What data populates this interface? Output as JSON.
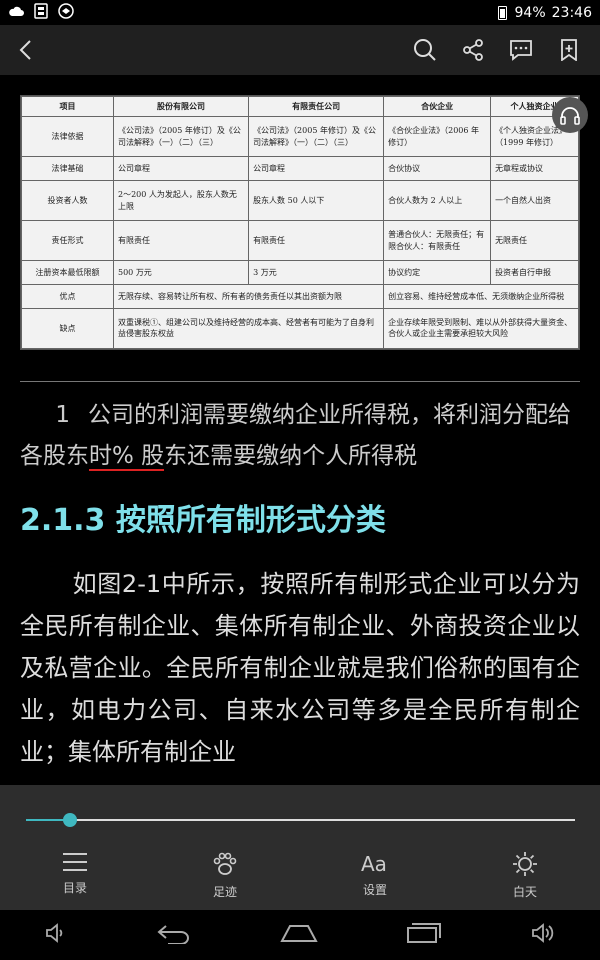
{
  "status_bar": {
    "battery": "94%",
    "time": "23:46"
  },
  "table": {
    "headers": [
      "项目",
      "股份有限公司",
      "有限责任公司",
      "合伙企业",
      "个人独资企业"
    ],
    "rows": [
      [
        "法律依据",
        "《公司法》（2005 年修订）及《公司法解释》（一）（二）（三）",
        "《公司法》（2005 年修订）及《公司法解释》（一）（二）（三）",
        "《合伙企业法》（2006 年修订）",
        "《个人独资企业法》（1999 年修订）"
      ],
      [
        "法律基础",
        "公司章程",
        "公司章程",
        "合伙协议",
        "无章程或协议"
      ],
      [
        "投资者人数",
        "2～200 人为发起人，股东人数无上限",
        "股东人数 50 人以下",
        "合伙人数为 2 人以上",
        "一个自然人出资"
      ],
      [
        "责任形式",
        "有限责任",
        "有限责任",
        "普通合伙人：无限责任；有限合伙人：有限责任",
        "无限责任"
      ],
      [
        "注册资本最低限额",
        "500 万元",
        "3 万元",
        "协议约定",
        "投资者自行申报"
      ]
    ],
    "merged_rows": [
      [
        "优点",
        "无限存续、容易转让所有权、所有者的债务责任以其出资额为限",
        "创立容易、维持经营成本低、无须缴纳企业所得税"
      ],
      [
        "缺点",
        "双重课税①、组建公司以及维持经营的成本高、经营者有可能为了自身利益侵害股东权益",
        "企业存续年限受到限制、难以从外部获得大量资金、合伙人或企业主需要承担较大风险"
      ]
    ]
  },
  "footnote": {
    "number": "1",
    "text_before": "公司的利润需要缴纳企业所得税，将利润分配给各股东",
    "underlined": "时% 股",
    "text_after": "东还需要缴纳个人所得税"
  },
  "section": {
    "heading": "2.1.3 按照所有制形式分类",
    "paragraph": "如图2-1中所示，按照所有制形式企业可以分为全民所有制企业、集体所有制企业、外商投资企业以及私营企业。全民所有制企业就是我们俗称的国有企业，如电力公司、自来水公司等多是全民所有制企业；集体所有制企业"
  },
  "progress": {
    "value_percent": 8
  },
  "bottom_tabs": [
    {
      "label": "目录",
      "icon": "list-icon"
    },
    {
      "label": "足迹",
      "icon": "paw-icon"
    },
    {
      "label": "设置",
      "icon": "font-settings-icon"
    },
    {
      "label": "白天",
      "icon": "sun-icon"
    }
  ],
  "colors": {
    "accent": "#3fb8c0",
    "heading": "#7fe0ea",
    "underline": "#dd2222"
  }
}
